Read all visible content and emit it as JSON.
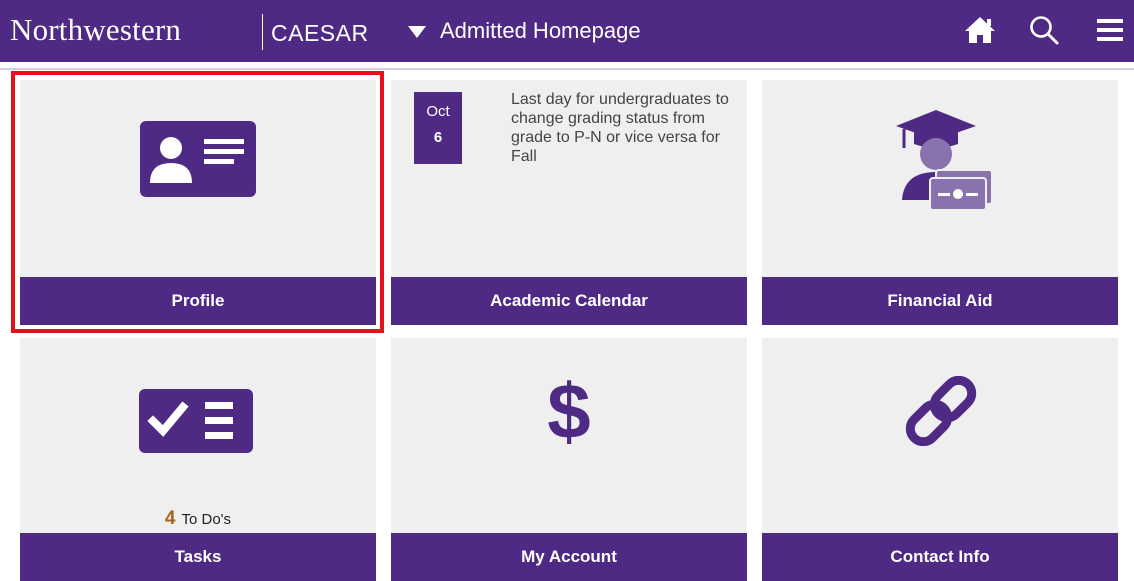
{
  "header": {
    "brand": "Northwestern",
    "app": "CAESAR",
    "page_title": "Admitted Homepage",
    "icons": [
      "home-icon",
      "search-icon",
      "menu-icon"
    ]
  },
  "colors": {
    "purple": "#4e2a84",
    "tile_bg": "#efeff0",
    "highlight": "#e4111b",
    "todo_count": "#a8631c"
  },
  "tiles": {
    "profile": {
      "label": "Profile",
      "icon": "id-card-icon"
    },
    "calendar": {
      "label": "Academic Calendar",
      "month": "Oct",
      "day": "6",
      "event": "Last day for undergraduates to change grading status from grade to P-N or vice versa for Fall"
    },
    "financial_aid": {
      "label": "Financial Aid",
      "icon": "graduate-with-cards-icon"
    },
    "tasks": {
      "label": "Tasks",
      "icon": "checklist-icon",
      "todo_count": "4",
      "todo_label": "To Do's"
    },
    "my_account": {
      "label": "My Account",
      "icon": "dollar-icon"
    },
    "contact_info": {
      "label": "Contact Info",
      "icon": "link-icon"
    }
  }
}
